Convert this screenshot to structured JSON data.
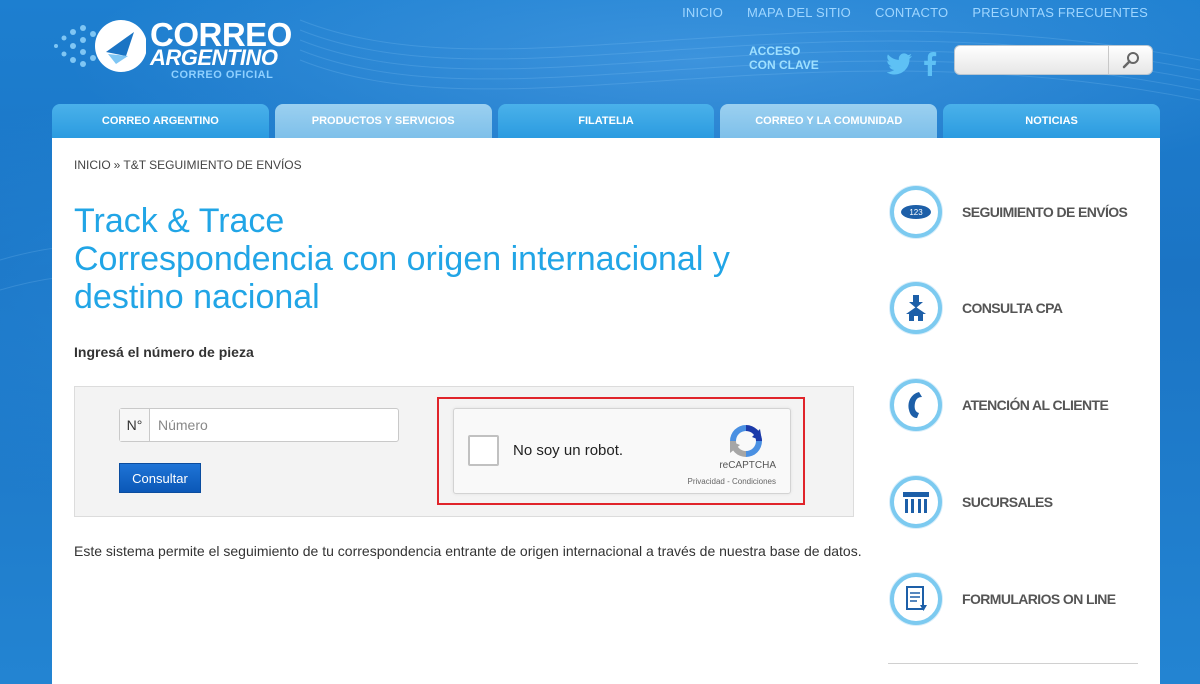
{
  "header": {
    "brand_line1": "CORREO",
    "brand_line2": "ARGENTINO",
    "brand_line3": "CORREO OFICIAL",
    "top_links": [
      "INICIO",
      "MAPA DEL SITIO",
      "CONTACTO",
      "PREGUNTAS FRECUENTES"
    ],
    "acceso_line1": "ACCESO",
    "acceso_line2": "CON CLAVE",
    "search_placeholder": ""
  },
  "main_nav": [
    "CORREO ARGENTINO",
    "PRODUCTOS Y SERVICIOS",
    "FILATELIA",
    "CORREO Y LA COMUNIDAD",
    "NOTICIAS"
  ],
  "breadcrumb": {
    "home": "INICIO",
    "sep": "»",
    "current": "T&T SEGUIMIENTO DE ENVÍOS"
  },
  "page": {
    "title_line1": "Track & Trace",
    "title_line2": "Correspondencia con origen internacional y destino nacional",
    "input_label": "Ingresá el número de pieza",
    "number_prefix": "N°",
    "number_placeholder": "Número",
    "submit_label": "Consultar",
    "description": "Este sistema permite el seguimiento de tu correspondencia entrante de origen internacional a través de nuestra base de datos."
  },
  "captcha": {
    "label": "No soy un robot.",
    "brand": "reCAPTCHA",
    "terms": "Privacidad - Condiciones"
  },
  "sidebar": {
    "items": [
      {
        "label": "SEGUIMIENTO DE ENVÍOS",
        "icon": "tracking-icon",
        "icon_text": "123"
      },
      {
        "label": "CONSULTA CPA",
        "icon": "house-arrow-icon"
      },
      {
        "label": "ATENCIÓN AL CLIENTE",
        "icon": "phone-icon"
      },
      {
        "label": "SUCURSALES",
        "icon": "branch-icon"
      },
      {
        "label": "FORMULARIOS ON LINE",
        "icon": "form-icon"
      }
    ]
  },
  "colors": {
    "title_blue": "#21a5e6",
    "nav_blue": "#2b9be0",
    "button_blue": "#0b58b7",
    "highlight_red": "#e0242a"
  }
}
